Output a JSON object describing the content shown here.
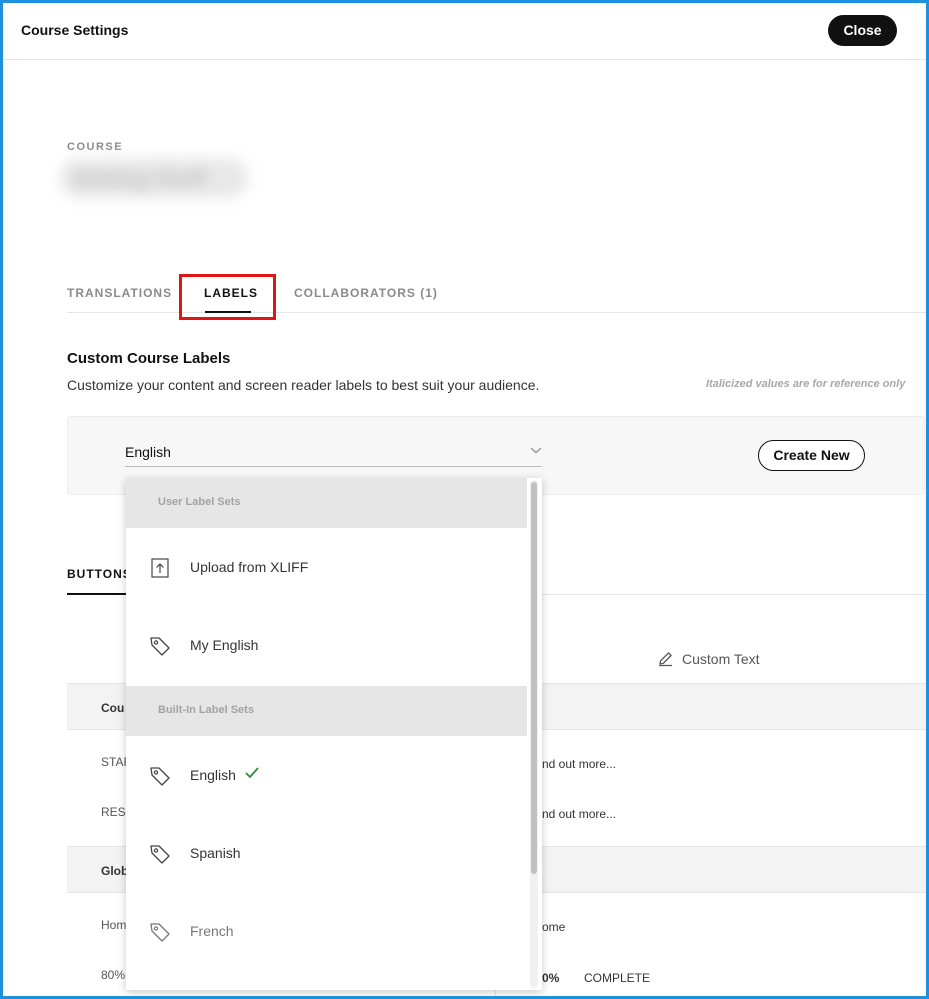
{
  "header": {
    "title": "Course Settings",
    "close_label": "Close"
  },
  "course": {
    "kicker": "COURSE",
    "name": "Getting Stuff"
  },
  "tabs": [
    {
      "label": "TRANSLATIONS"
    },
    {
      "label": "LABELS",
      "active": true
    },
    {
      "label": "COLLABORATORS (1)"
    }
  ],
  "labels_section": {
    "title": "Custom Course Labels",
    "description": "Customize your content and screen reader labels to best suit your audience.",
    "reference_note": "Italicized values are for reference only",
    "selected_language": "English",
    "create_new_label": "Create New"
  },
  "background": {
    "sub_tab": "BUTTONS",
    "custom_text_header": "Custom Text",
    "band1_label": "Cou",
    "band2_label": "Glob",
    "rows": [
      {
        "key": "STAR",
        "value": "nd out more..."
      },
      {
        "key": "RESU",
        "value": "nd out more..."
      },
      {
        "key": "Hom",
        "value": "ome"
      },
      {
        "key": "80%",
        "value": "0%",
        "extra": "COMPLETE"
      }
    ]
  },
  "dropdown": {
    "group_user": "User Label Sets",
    "group_builtin": "Built-In Label Sets",
    "items": [
      {
        "label": "Upload from XLIFF",
        "icon": "upload-icon"
      },
      {
        "label": "My English",
        "icon": "tag-icon"
      },
      {
        "label": "English",
        "icon": "tag-icon",
        "selected": true
      },
      {
        "label": "Spanish",
        "icon": "tag-icon"
      },
      {
        "label": "French",
        "icon": "tag-icon"
      }
    ]
  },
  "colors": {
    "frame": "#1f8fe0",
    "highlight": "#e01515",
    "check": "#2e8b3e"
  }
}
